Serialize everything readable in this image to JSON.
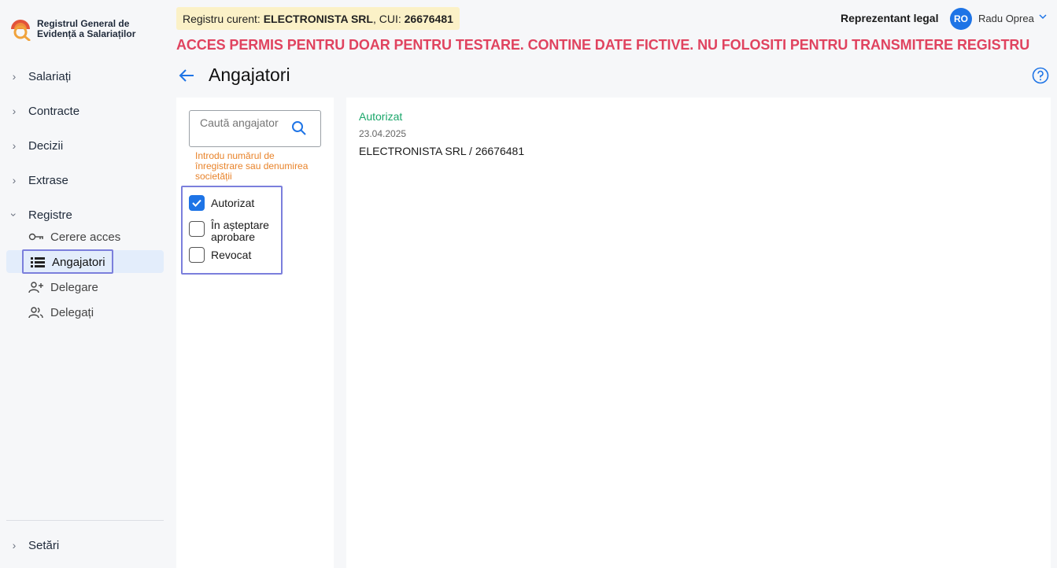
{
  "app": {
    "logo_line1": "Registrul General de",
    "logo_line2": "Evidență a Salariaților"
  },
  "sidebar": {
    "items": [
      {
        "label": "Salariați"
      },
      {
        "label": "Contracte"
      },
      {
        "label": "Decizii"
      },
      {
        "label": "Extrase"
      },
      {
        "label": "Registre"
      }
    ],
    "sub_items": [
      {
        "label": "Cerere acces",
        "icon": "key-icon"
      },
      {
        "label": "Angajatori",
        "icon": "list-icon",
        "active": true
      },
      {
        "label": "Delegare",
        "icon": "user-add-icon"
      },
      {
        "label": "Delegați",
        "icon": "users-icon"
      }
    ],
    "settings_label": "Setări"
  },
  "header": {
    "registry_prefix": "Registru curent: ",
    "registry_name": "ELECTRONISTA SRL",
    "registry_cui_prefix": ", CUI: ",
    "registry_cui": "26676481",
    "warning": "ACCES PERMIS PENTRU DOAR PENTRU TESTARE. CONTINE DATE FICTIVE. NU FOLOSITI PENTRU TRANSMITERE REGISTRU",
    "role": "Reprezentant legal",
    "avatar_initials": "RO",
    "user_name": "Radu Oprea"
  },
  "page": {
    "title": "Angajatori"
  },
  "filters": {
    "search_placeholder": "Caută angajator",
    "hint": "Introdu numărul de înregistrare sau denumirea societății",
    "options": [
      {
        "label_line1": "Autorizat",
        "label_line2": "",
        "checked": true
      },
      {
        "label_line1": "În așteptare",
        "label_line2": "aprobare",
        "checked": false
      },
      {
        "label_line1": "Revocat",
        "label_line2": "",
        "checked": false
      }
    ]
  },
  "results": [
    {
      "status": "Autorizat",
      "date": "23.04.2025",
      "name": "ELECTRONISTA SRL / 26676481"
    }
  ],
  "colors": {
    "accent": "#1e74e6",
    "warning": "#e0435f",
    "status_ok": "#1aa66a",
    "hint": "#e8832a",
    "highlight_border": "#7b7fdc"
  }
}
